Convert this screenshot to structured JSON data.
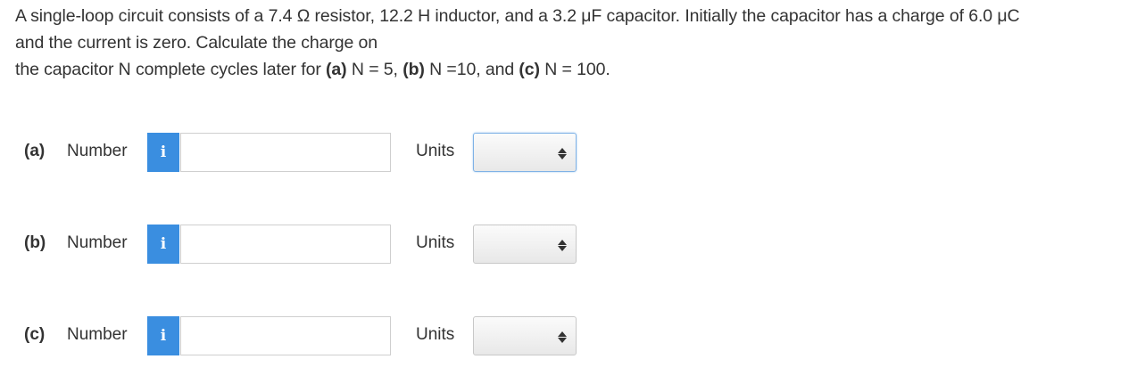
{
  "question": {
    "line1": "A single-loop circuit consists of a 7.4 Ω resistor, 12.2 H inductor, and a 3.2 μF capacitor. Initially the capacitor has a charge of 6.0 μC",
    "line2": "and the current is zero. Calculate the charge on",
    "line3_prefix": "the capacitor N complete cycles later for ",
    "part_a_tag": "(a)",
    "part_a_text": " N = 5, ",
    "part_b_tag": "(b)",
    "part_b_text": " N =10, and ",
    "part_c_tag": "(c)",
    "part_c_text": " N = 100."
  },
  "rows": [
    {
      "label": "(a)",
      "number_label": "Number",
      "info_icon": "i",
      "input_value": "",
      "units_label": "Units",
      "units_selected": ""
    },
    {
      "label": "(b)",
      "number_label": "Number",
      "info_icon": "i",
      "input_value": "",
      "units_label": "Units",
      "units_selected": ""
    },
    {
      "label": "(c)",
      "number_label": "Number",
      "info_icon": "i",
      "input_value": "",
      "units_label": "Units",
      "units_selected": ""
    }
  ],
  "colors": {
    "info_button": "#3a8ee0",
    "text": "#333333",
    "focus_border": "#7fb2e6"
  }
}
